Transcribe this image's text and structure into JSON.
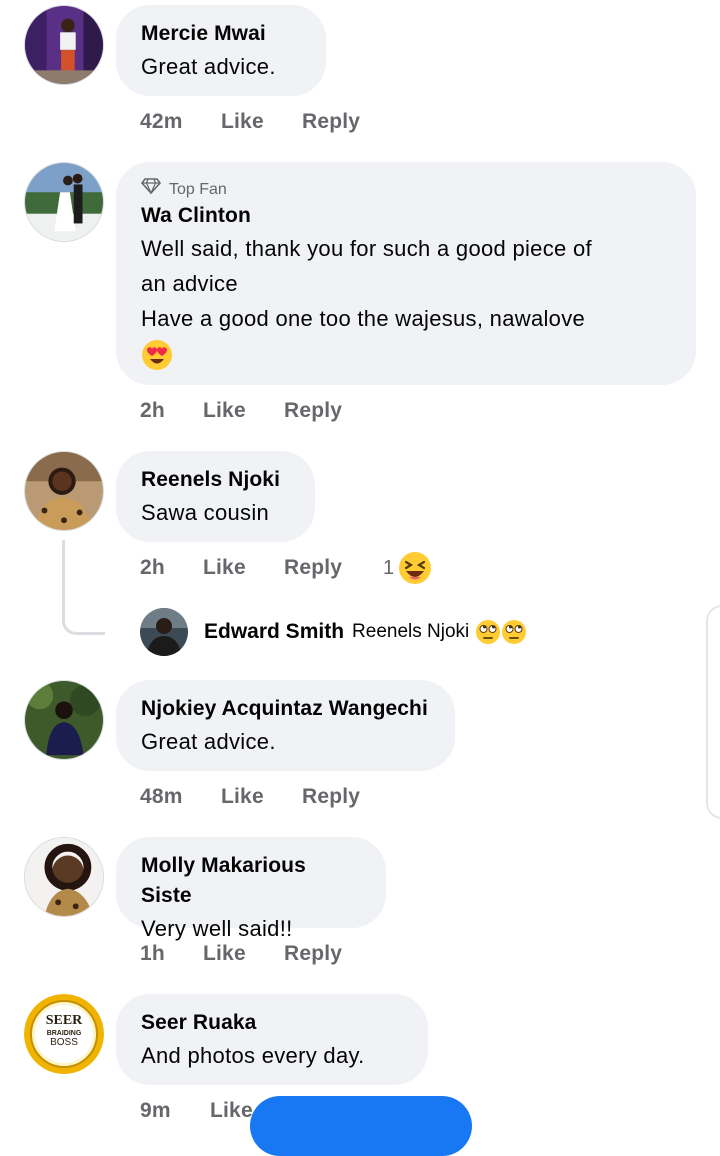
{
  "comments": [
    {
      "name": "Mercie Mwai",
      "text": [
        "Great advice."
      ],
      "time": "42m",
      "like": "Like",
      "reply": "Reply"
    },
    {
      "badge": "Top Fan",
      "name": "Wa Clinton",
      "text": [
        "Well said, thank you for such a good piece of",
        "an advice",
        "Have a good one too the wajesus, nawalove"
      ],
      "emoji": "heart-eyes-emoji",
      "time": "2h",
      "like": "Like",
      "reply": "Reply"
    },
    {
      "name": "Reenels Njoki",
      "text": [
        "Sawa cousin"
      ],
      "time": "2h",
      "like": "Like",
      "reply": "Reply",
      "reaction_count": "1",
      "reaction": "laughing-emoji"
    },
    {
      "name": "Njokiey Acquintaz Wangechi",
      "text": [
        "Great advice."
      ],
      "time": "48m",
      "like": "Like",
      "reply": "Reply"
    },
    {
      "name": "Molly Makarious Siste",
      "text": [
        "Very well said!!"
      ],
      "time": "1h",
      "like": "Like",
      "reply": "Reply"
    },
    {
      "name": "Seer Ruaka",
      "text": [
        "And photos every day."
      ],
      "time": "9m",
      "like": "Like"
    }
  ],
  "reply_preview": {
    "name": "Edward Smith",
    "text": "Reenels Njoki",
    "emojis": [
      "eye-roll-emoji",
      "eye-roll-emoji"
    ]
  },
  "logo": {
    "line1": "SEER",
    "line2": "BRAIDING",
    "line3": "BOSS"
  },
  "colors": {
    "bubble": "#f0f2f5",
    "meta": "#65676b",
    "text": "#050505",
    "accent": "#1877f2"
  }
}
